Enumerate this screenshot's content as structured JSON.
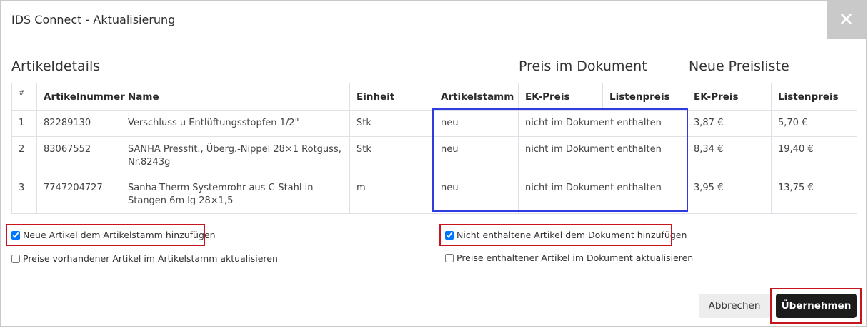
{
  "dialog": {
    "title": "IDS Connect - Aktualisierung",
    "close_icon": "close-icon"
  },
  "sections": {
    "details": "Artikeldetails",
    "document": "Preis im Dokument",
    "pricelist": "Neue Preisliste"
  },
  "table": {
    "headers": [
      "#",
      "Artikelnummer",
      "Name",
      "Einheit",
      "Artikelstamm",
      "EK-Preis",
      "Listenpreis",
      "EK-Preis",
      "Listenpreis"
    ],
    "rows": [
      {
        "num": "1",
        "artnr": "82289130",
        "name": "Verschluss u Entlüftungsstopfen 1/2\"",
        "unit": "Stk",
        "stamm": "neu",
        "doc_price": "nicht im Dokument enthalten",
        "ek": "3,87 €",
        "list": "5,70 €"
      },
      {
        "num": "2",
        "artnr": "83067552",
        "name": "SANHA Pressfit., Überg.-Nippel 28×1 Rotguss, Nr.8243g",
        "unit": "Stk",
        "stamm": "neu",
        "doc_price": "nicht im Dokument enthalten",
        "ek": "8,34 €",
        "list": "19,40 €"
      },
      {
        "num": "3",
        "artnr": "7747204727",
        "name": "Sanha-Therm Systemrohr aus C-Stahl in Stangen 6m lg 28×1,5",
        "unit": "m",
        "stamm": "neu",
        "doc_price": "nicht im Dokument enthalten",
        "ek": "3,95 €",
        "list": "13,75 €"
      }
    ]
  },
  "options": {
    "add_new": {
      "label": "Neue Artikel dem Artikelstamm hinzufügen",
      "checked": true
    },
    "update_prices": {
      "label": "Preise vorhandener Artikel im Artikelstamm aktualisieren",
      "checked": false
    },
    "add_missing": {
      "label": "Nicht enthaltene Artikel dem Dokument hinzufügen",
      "checked": true
    },
    "update_doc_prices": {
      "label": "Preise enthaltener Artikel im Dokument aktualisieren",
      "checked": false
    }
  },
  "footer": {
    "cancel": "Abbrechen",
    "apply": "Übernehmen"
  },
  "colors": {
    "highlight_blue": "#2f3ae0",
    "highlight_red": "#c8141c",
    "primary_button": "#1c1c1c"
  }
}
